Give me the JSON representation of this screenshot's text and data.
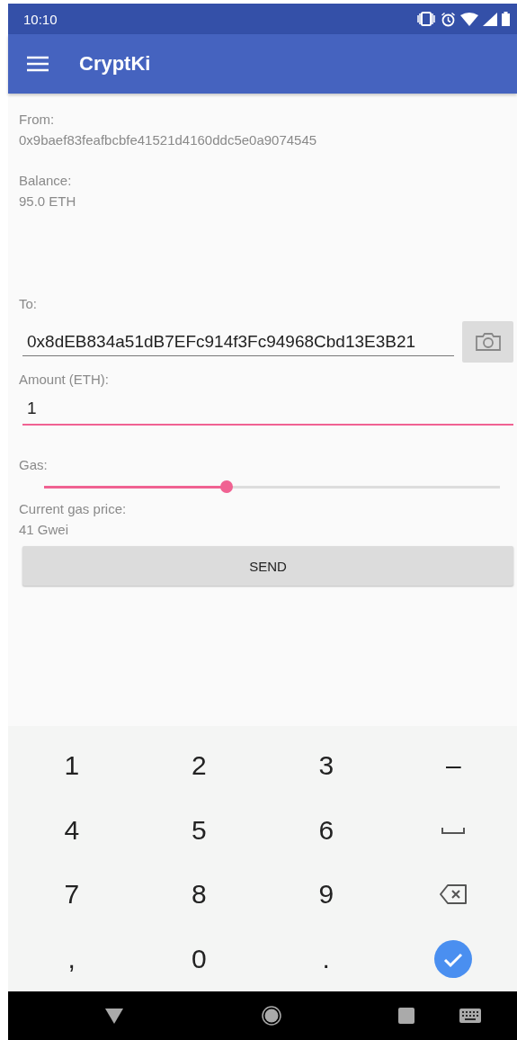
{
  "status_bar": {
    "time": "10:10"
  },
  "app_bar": {
    "title": "CryptKi"
  },
  "from": {
    "label": "From:",
    "value": "0x9baef83feafbcbfe41521d4160ddc5e0a9074545"
  },
  "balance": {
    "label": "Balance:",
    "value": "95.0 ETH"
  },
  "to": {
    "label": "To:",
    "value": "0x8dEB834a51dB7EFc914f3Fc94968Cbd13E3B21"
  },
  "amount": {
    "label": "Amount (ETH):",
    "value": "1",
    "focused": true
  },
  "gas": {
    "label": "Gas:",
    "level": 0.4
  },
  "gas_price": {
    "label": "Current gas price:",
    "value": "41 Gwei"
  },
  "send_button": {
    "label": "SEND"
  },
  "keyboard": {
    "keys": [
      {
        "kind": "text",
        "label": "1"
      },
      {
        "kind": "text",
        "label": "2"
      },
      {
        "kind": "text",
        "label": "3"
      },
      {
        "kind": "text",
        "label": "–"
      },
      {
        "kind": "text",
        "label": "4"
      },
      {
        "kind": "text",
        "label": "5"
      },
      {
        "kind": "text",
        "label": "6"
      },
      {
        "kind": "space"
      },
      {
        "kind": "text",
        "label": "7"
      },
      {
        "kind": "text",
        "label": "8"
      },
      {
        "kind": "text",
        "label": "9"
      },
      {
        "kind": "backspace"
      },
      {
        "kind": "text",
        "label": ","
      },
      {
        "kind": "text",
        "label": "0"
      },
      {
        "kind": "text",
        "label": "."
      },
      {
        "kind": "done"
      }
    ]
  }
}
